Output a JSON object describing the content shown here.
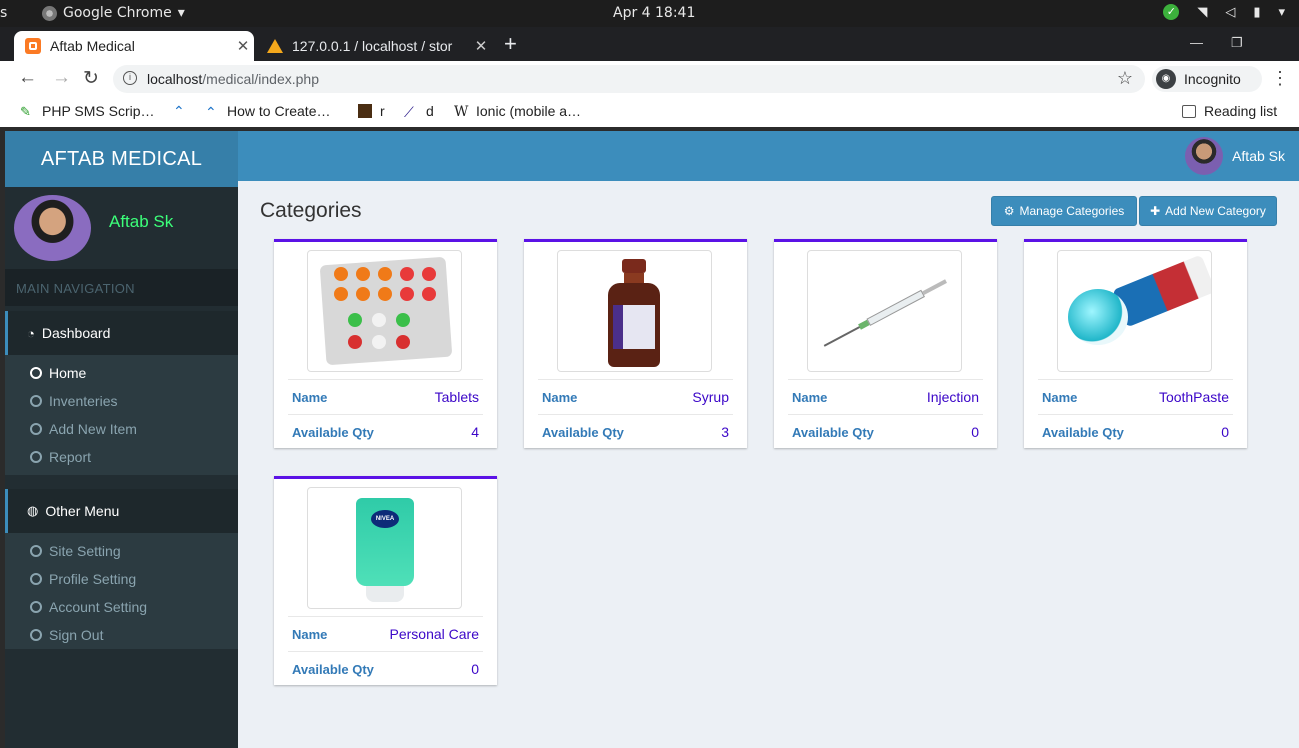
{
  "os": {
    "left_fragment": "s",
    "app_name": "Google Chrome",
    "clock": "Apr 4  18:41"
  },
  "browser": {
    "tabs": [
      {
        "title": "Aftab Medical",
        "active": true
      },
      {
        "title": "127.0.0.1 / localhost / stor",
        "active": false
      }
    ],
    "url_host": "localhost",
    "url_path": "/medical/index.php",
    "profile": "Incognito",
    "bookmarks": [
      "PHP SMS Scrip…",
      "How to Create…",
      "r",
      "d",
      "Ionic (mobile a…"
    ],
    "reading_list": "Reading list"
  },
  "app": {
    "brand": "AFTAB MEDICAL",
    "user_name": "Aftab Sk",
    "nav_header": "MAIN NAVIGATION",
    "dashboard": {
      "label": "Dashboard",
      "items": [
        "Home",
        "Inventeries",
        "Add New Item",
        "Report"
      ]
    },
    "other_menu": {
      "label": "Other Menu",
      "items": [
        "Site Setting",
        "Profile Setting",
        "Account Setting",
        "Sign Out"
      ]
    },
    "page_title": "Categories",
    "buttons": {
      "manage": "Manage Categories",
      "add": "Add New Category"
    },
    "labels": {
      "name": "Name",
      "qty": "Available Qty"
    },
    "categories": [
      {
        "name": "Tablets",
        "qty": "4",
        "image": "tablets"
      },
      {
        "name": "Syrup",
        "qty": "3",
        "image": "syrup"
      },
      {
        "name": "Injection",
        "qty": "0",
        "image": "injection"
      },
      {
        "name": "ToothPaste",
        "qty": "0",
        "image": "toothpaste"
      },
      {
        "name": "Personal Care",
        "qty": "0",
        "image": "face-wash"
      }
    ]
  },
  "colors": {
    "brand_header": "#367fa9",
    "topbar": "#3c8dbc",
    "sidebar": "#222d32",
    "card_accent": "#5b12e6",
    "user_name_green": "#3cff7a"
  }
}
